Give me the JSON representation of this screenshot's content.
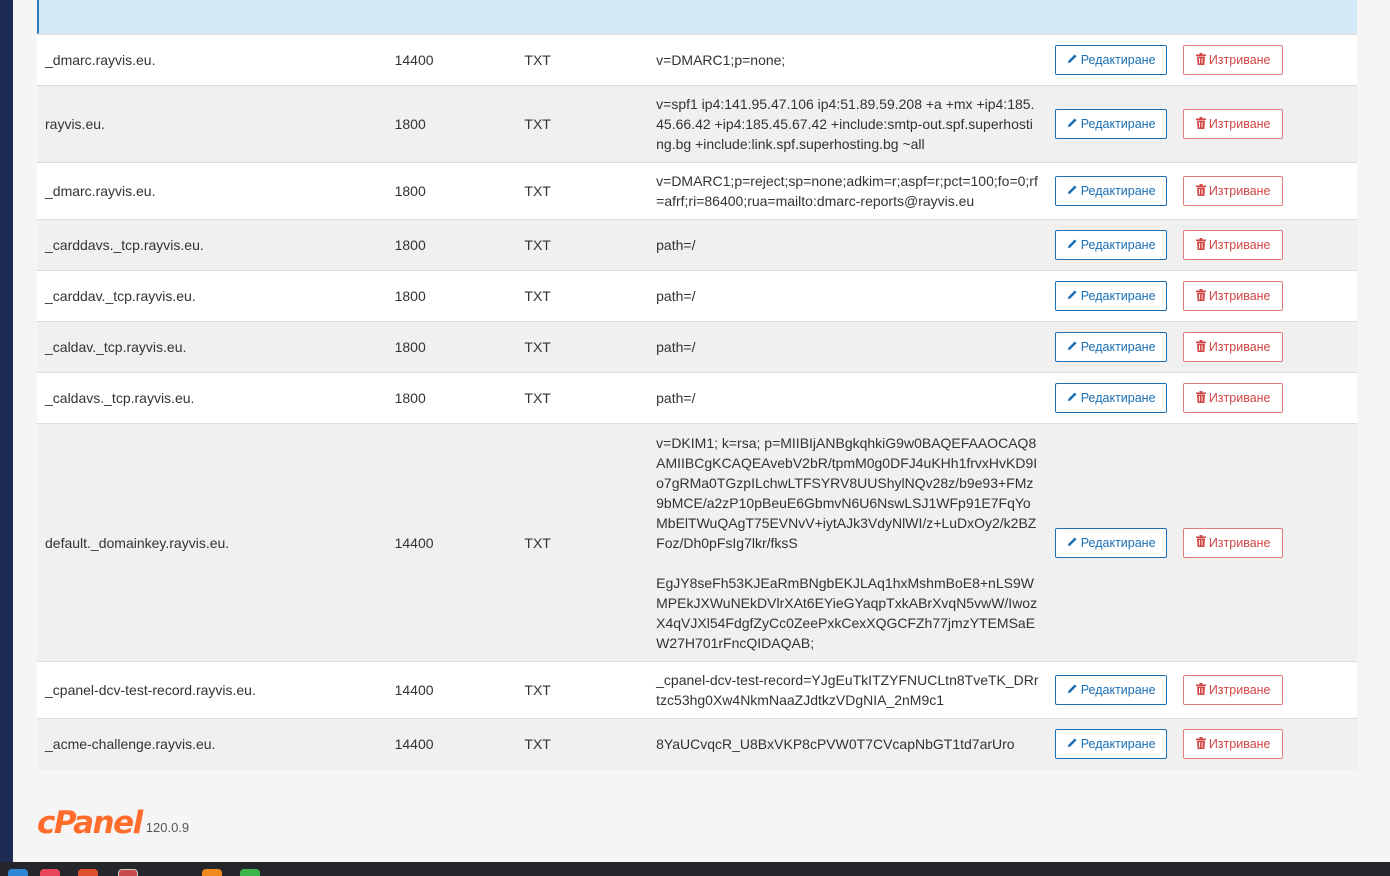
{
  "buttons": {
    "edit_label": "Редактиране",
    "delete_label": "Изтриване"
  },
  "records": [
    {
      "name": "_dmarc.rayvis.eu.",
      "ttl": "14400",
      "type": "TXT",
      "value": "v=DMARC1;p=none;"
    },
    {
      "name": "rayvis.eu.",
      "ttl": "1800",
      "type": "TXT",
      "value": "v=spf1 ip4:141.95.47.106 ip4:51.89.59.208 +a +mx +ip4:185.45.66.42 +ip4:185.45.67.42 +include:smtp-out.spf.superhosting.bg +include:link.spf.superhosting.bg ~all"
    },
    {
      "name": "_dmarc.rayvis.eu.",
      "ttl": "1800",
      "type": "TXT",
      "value": "v=DMARC1;p=reject;sp=none;adkim=r;aspf=r;pct=100;fo=0;rf=afrf;ri=86400;rua=mailto:dmarc-reports@rayvis.eu"
    },
    {
      "name": "_carddavs._tcp.rayvis.eu.",
      "ttl": "1800",
      "type": "TXT",
      "value": "path=/"
    },
    {
      "name": "_carddav._tcp.rayvis.eu.",
      "ttl": "1800",
      "type": "TXT",
      "value": "path=/"
    },
    {
      "name": "_caldav._tcp.rayvis.eu.",
      "ttl": "1800",
      "type": "TXT",
      "value": "path=/"
    },
    {
      "name": "_caldavs._tcp.rayvis.eu.",
      "ttl": "1800",
      "type": "TXT",
      "value": "path=/"
    },
    {
      "name": "default._domainkey.rayvis.eu.",
      "ttl": "14400",
      "type": "TXT",
      "value": "v=DKIM1; k=rsa; p=MIIBIjANBgkqhkiG9w0BAQEFAAOCAQ8AMIIBCgKCAQEAvebV2bR/tpmM0g0DFJ4uKHh1frvxHvKD9Io7gRMa0TGzpILchwLTFSYRV8UUShylNQv28z/b9e93+FMz9bMCE/a2zP10pBeuE6GbmvN6U6NswLSJ1WFp91E7FqYoMbElTWuQAgT75EVNvV+iytAJk3VdyNlWI/z+LuDxOy2/k2BZFoz/Dh0pFsIg7lkr/fksS",
      "value2": "EgJY8seFh53KJEaRmBNgbEKJLAq1hxMshmBoE8+nLS9WMPEkJXWuNEkDVlrXAt6EYieGYaqpTxkABrXvqN5vwW/IwozX4qVJXl54FdgfZyCc0ZeePxkCexXQGCFZh77jmzYTEMSaEW27H701rFncQIDAQAB;"
    },
    {
      "name": "_cpanel-dcv-test-record.rayvis.eu.",
      "ttl": "14400",
      "type": "TXT",
      "value": "_cpanel-dcv-test-record=YJgEuTkITZYFNUCLtn8TveTK_DRrtzc53hg0Xw4NkmNaaZJdtkzVDgNIA_2nM9c1"
    },
    {
      "name": "_acme-challenge.rayvis.eu.",
      "ttl": "14400",
      "type": "TXT",
      "value": "8YaUCvqcR_U8BxVKP8cPVW0T7CVcapNbGT1td7arUro"
    }
  ],
  "footer": {
    "logo_text": "cPanel",
    "version": "120.0.9"
  },
  "icons": {
    "edit": "pencil-icon",
    "delete": "trash-icon"
  },
  "colors": {
    "edit_button": "#1a6fb5",
    "delete_button": "#d24646",
    "cpanel_logo": "#ff6c2c",
    "sidebar": "#1b2b52"
  }
}
